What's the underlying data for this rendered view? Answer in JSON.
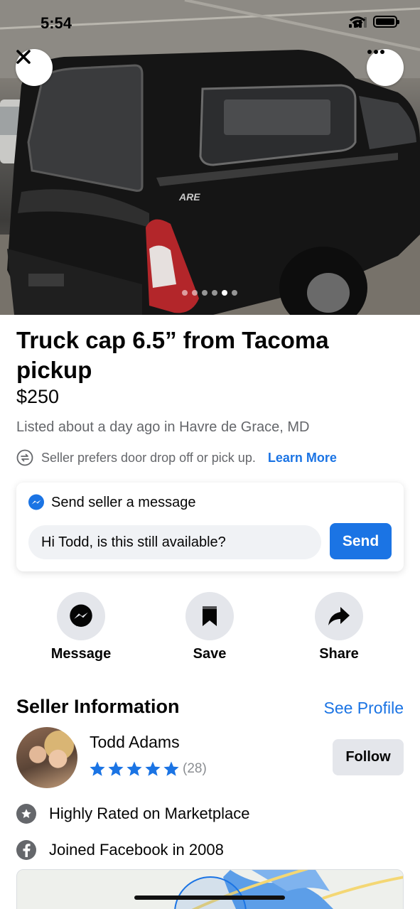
{
  "status_bar": {
    "time": "5:54"
  },
  "photo": {
    "page_indicator": {
      "count": 6,
      "active_index": 4
    },
    "decal_text": "ARE"
  },
  "listing": {
    "title": "Truck cap 6.5” from Tacoma pickup",
    "price": "$250",
    "listed_text": "Listed about a day ago in Havre de Grace, MD",
    "delivery_pref": "Seller prefers door drop off or pick up.",
    "learn_more": "Learn More"
  },
  "message_card": {
    "heading": "Send seller a message",
    "input_value": "Hi Todd, is this still available?",
    "send_label": "Send"
  },
  "actions": [
    {
      "label": "Message",
      "icon": "messenger-icon"
    },
    {
      "label": "Save",
      "icon": "bookmark-icon"
    },
    {
      "label": "Share",
      "icon": "share-arrow-icon"
    }
  ],
  "seller": {
    "section_title": "Seller Information",
    "see_profile": "See Profile",
    "name": "Todd Adams",
    "rating_stars": 5,
    "rating_count": "(28)",
    "follow_label": "Follow",
    "facts": [
      {
        "icon": "star-badge-icon",
        "text": "Highly Rated on Marketplace"
      },
      {
        "icon": "facebook-icon",
        "text": "Joined Facebook in 2008"
      }
    ]
  },
  "colors": {
    "accent": "#1b74e4",
    "secondary_text": "#65676b",
    "button_gray": "#e4e6eb",
    "input_gray": "#f0f2f5"
  }
}
